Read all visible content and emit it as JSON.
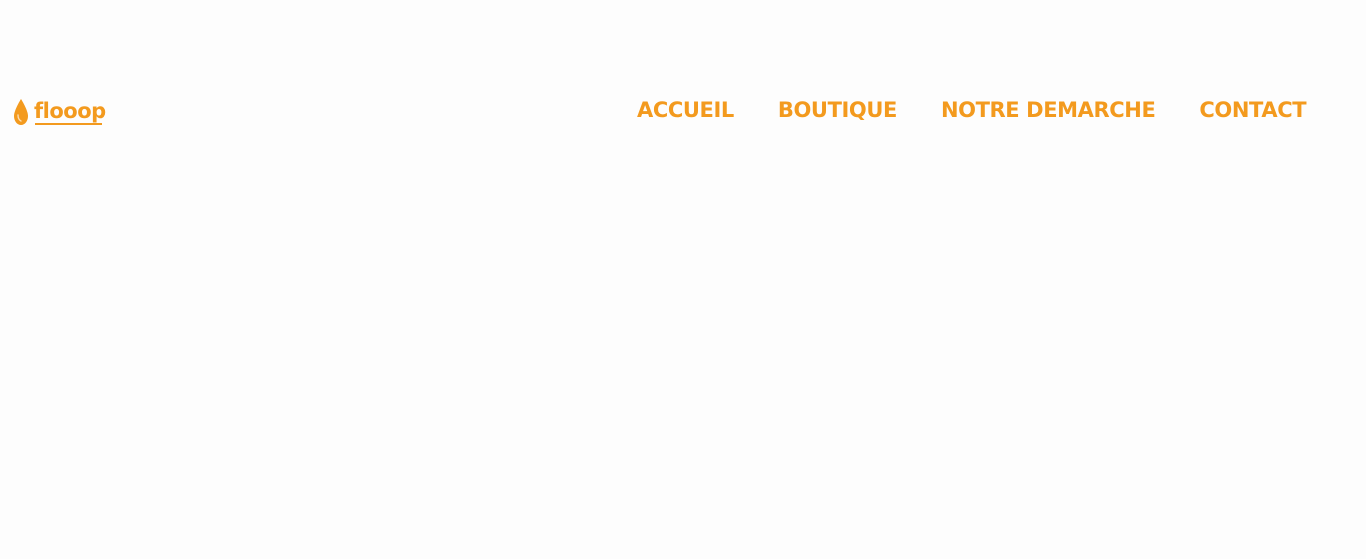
{
  "brand": {
    "name": "flooop",
    "icon": "drop-icon",
    "color": "#f39a1e"
  },
  "nav": {
    "items": [
      {
        "label": "ACCUEIL"
      },
      {
        "label": "BOUTIQUE"
      },
      {
        "label": "NOTRE DEMARCHE"
      },
      {
        "label": "CONTACT"
      }
    ]
  },
  "colors": {
    "accent": "#f39a1e",
    "background": "#fdfdfd"
  }
}
